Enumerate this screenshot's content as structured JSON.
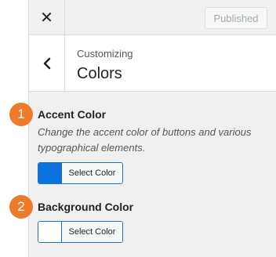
{
  "topbar": {
    "close_icon": "close-icon",
    "close_glyph": "✕",
    "publish_label": "Published"
  },
  "section": {
    "back_icon": "chevron-left-icon",
    "breadcrumb": "Customizing",
    "title": "Colors"
  },
  "controls": [
    {
      "step": "1",
      "title": "Accent Color",
      "description_line1": "Change the accent color of buttons and various",
      "description_line2": "typographical elements.",
      "button_label": "Select Color",
      "swatch_color": "#0a73e0"
    },
    {
      "step": "2",
      "title": "Background Color",
      "button_label": "Select Color",
      "swatch_color": "#ffffff"
    }
  ],
  "colors": {
    "badge": "#ef7a2a",
    "accent": "#2271b1",
    "panel_bg": "#f0f0f1"
  }
}
